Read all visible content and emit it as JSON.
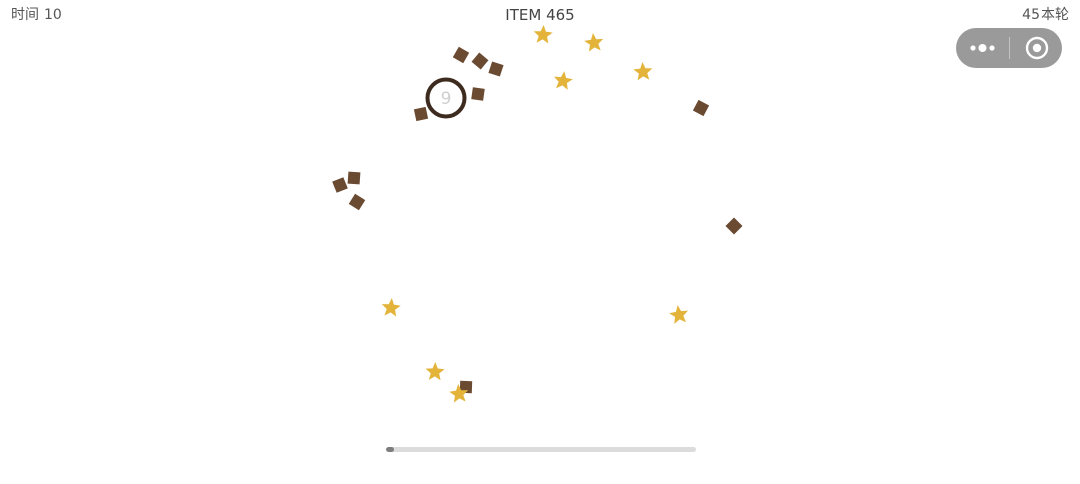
{
  "hud": {
    "time_label": "时间",
    "time_value": "10",
    "item_title": "ITEM 465",
    "round_value": "45",
    "round_label": "本轮"
  },
  "player": {
    "number": "9"
  },
  "progress": {
    "fraction": 0.025
  },
  "icons": {
    "capsule_more": "more-dots-icon",
    "capsule_close": "target-close-icon",
    "star": "star-icon",
    "crate": "square-crate-icon"
  },
  "colors": {
    "star": "#e3b33a",
    "crate": "#6b4a32",
    "player_ring": "#3d2b1f",
    "capsule": "#9a9a9a",
    "progress_track": "#dcdcdc",
    "progress_fill": "#7d7d7d"
  }
}
